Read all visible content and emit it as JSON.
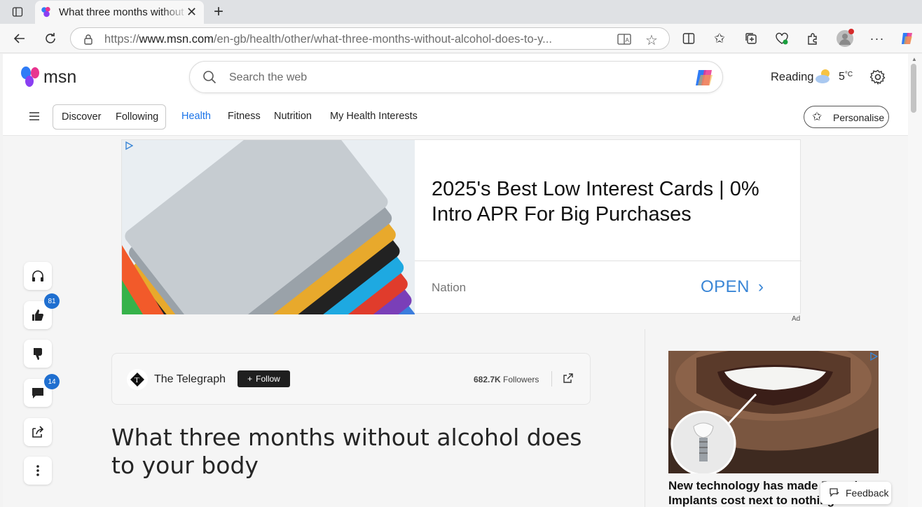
{
  "browser": {
    "tab_title": "What three months without alcohol does to your body",
    "url_prefix": "https://",
    "url_domain": "www.msn.com",
    "url_path": "/en-gb/health/other/what-three-months-without-alcohol-does-to-y..."
  },
  "header": {
    "logo_text": "msn",
    "search_placeholder": "Search the web",
    "reading_label": "Reading",
    "temperature": "5",
    "temp_unit": "°C"
  },
  "nav": {
    "discover": "Discover",
    "following": "Following",
    "items": [
      "Health",
      "Fitness",
      "Nutrition",
      "My Health Interests"
    ],
    "personalise": "Personalise"
  },
  "rail": {
    "like_count": "81",
    "comment_count": "14"
  },
  "ad": {
    "headline": "2025's Best Low Interest Cards | 0% Intro APR For Big Purchases",
    "sponsor": "Nation",
    "cta": "OPEN",
    "tag": "Ad"
  },
  "article": {
    "source_name": "The Telegraph",
    "follow_label": "Follow",
    "followers_count": "682.7K",
    "followers_label": "Followers",
    "title": "What three months without alcohol does to your body"
  },
  "side_ad": {
    "text_line1": "New technology has made Dental",
    "text_line2": "Implants cost next to nothing"
  },
  "feedback_label": "Feedback",
  "colors": {
    "accent": "#1a73e8",
    "ad_cta": "#3a86d6",
    "badge": "#1f6fd0"
  }
}
